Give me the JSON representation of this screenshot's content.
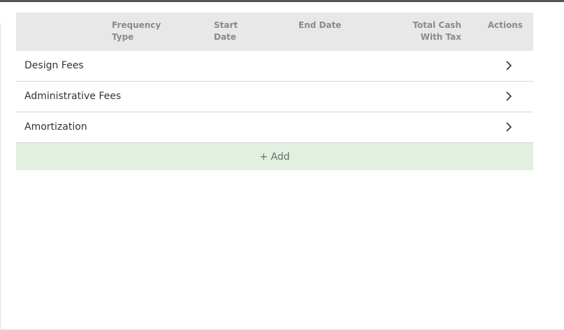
{
  "table": {
    "headers": {
      "name": "",
      "frequency_type": "Frequency\nType",
      "start_date": "Start\nDate",
      "end_date": "End Date",
      "total_cash_with_tax": "Total Cash\nWith Tax",
      "actions": "Actions"
    },
    "rows": [
      {
        "name": "Design Fees",
        "frequency_type": "",
        "start_date": "",
        "end_date": "",
        "total_cash_with_tax": "",
        "action_icon": "chevron-right-icon"
      },
      {
        "name": "Administrative Fees",
        "frequency_type": "",
        "start_date": "",
        "end_date": "",
        "total_cash_with_tax": "",
        "action_icon": "chevron-right-icon"
      },
      {
        "name": "Amortization",
        "frequency_type": "",
        "start_date": "",
        "end_date": "",
        "total_cash_with_tax": "",
        "action_icon": "chevron-right-icon"
      }
    ],
    "add_label": "+ Add"
  },
  "colors": {
    "header_bg": "#e8e8e8",
    "header_text": "#8a8a8a",
    "add_row_bg": "#e1f0e1",
    "row_divider": "#d6d6d6"
  }
}
